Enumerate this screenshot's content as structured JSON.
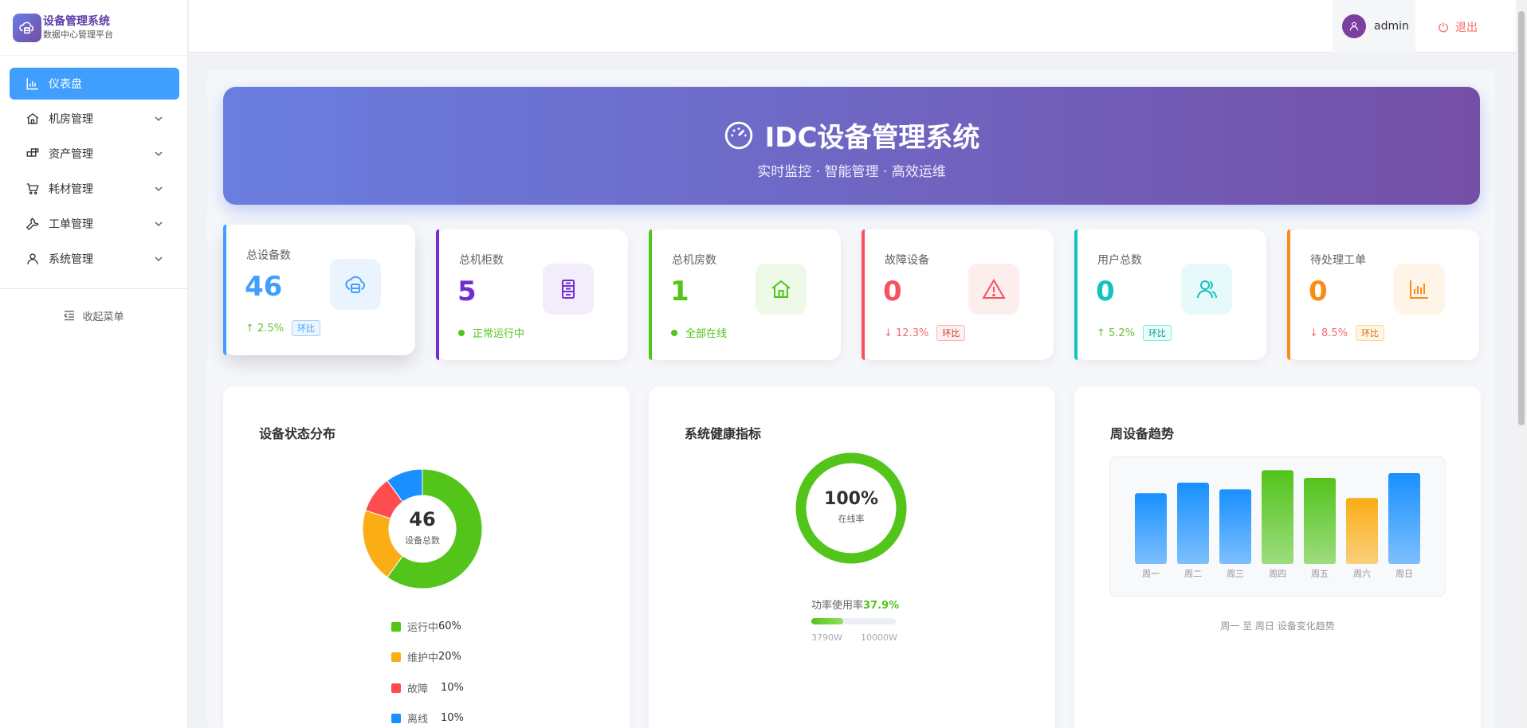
{
  "app": {
    "title": "设备管理系统",
    "subtitle": "数据中心管理平台"
  },
  "sidebar": {
    "items": [
      {
        "label": "仪表盘",
        "icon": "chart-bar-icon",
        "active": true
      },
      {
        "label": "机房管理",
        "icon": "home-icon"
      },
      {
        "label": "资产管理",
        "icon": "grid-icon"
      },
      {
        "label": "耗材管理",
        "icon": "cart-icon"
      },
      {
        "label": "工单管理",
        "icon": "wrench-icon"
      },
      {
        "label": "系统管理",
        "icon": "user-icon"
      }
    ],
    "collapse_label": "收起菜单"
  },
  "header": {
    "user": "admin",
    "logout": "退出"
  },
  "banner": {
    "title": "IDC设备管理系统",
    "subtitle": "实时监控 · 智能管理 · 高效运维"
  },
  "stats": [
    {
      "label": "总设备数",
      "value": "46",
      "color": "#409eff",
      "icon": "cloud-server-icon",
      "trend": "↑ 2.5%",
      "trend_color": "#67c23a",
      "tag": "环比",
      "tag_color": "#409eff"
    },
    {
      "label": "总机柜数",
      "value": "5",
      "color": "#722ed1",
      "icon": "server-rack-icon",
      "status": "正常运行中",
      "status_color": "#52c41a"
    },
    {
      "label": "总机房数",
      "value": "1",
      "color": "#52c41a",
      "icon": "house-icon",
      "status": "全部在线",
      "status_color": "#52c41a"
    },
    {
      "label": "故障设备",
      "value": "0",
      "color": "#f5515f",
      "icon": "warning-icon",
      "trend": "↓ 12.3%",
      "trend_color": "#f56c6c",
      "tag": "环比",
      "tag_color": "#f56c6c"
    },
    {
      "label": "用户总数",
      "value": "0",
      "color": "#13c2c2",
      "icon": "users-icon",
      "trend": "↑ 5.2%",
      "trend_color": "#67c23a",
      "tag": "环比",
      "tag_color": "#13c2c2"
    },
    {
      "label": "待处理工单",
      "value": "0",
      "color": "#fa8c16",
      "icon": "bar-chart-icon",
      "trend": "↓ 8.5%",
      "trend_color": "#f56c6c",
      "tag": "环比",
      "tag_color": "#fa8c16"
    }
  ],
  "status_card": {
    "title": "设备状态分布",
    "total": "46",
    "total_label": "设备总数",
    "slices": [
      {
        "name": "运行中",
        "pct": "60%",
        "value": 60,
        "color": "#52c41a"
      },
      {
        "name": "维护中",
        "pct": "20%",
        "value": 20,
        "color": "#faad14"
      },
      {
        "name": "故障",
        "pct": "10%",
        "value": 10,
        "color": "#ff4d4f"
      },
      {
        "name": "离线",
        "pct": "10%",
        "value": 10,
        "color": "#1890ff"
      }
    ]
  },
  "health_card": {
    "title": "系统健康指标",
    "online_rate": "100%",
    "online_label": "在线率",
    "online_value": 100,
    "power_label": "功率使用率",
    "power_rate": "37.9%",
    "power_value": 37.9,
    "power_used": "3790W",
    "power_total": "10000W"
  },
  "trend_card": {
    "title": "周设备趋势",
    "note": "周一 至 周日 设备变化趋势"
  },
  "chart_data": {
    "type": "bar",
    "categories": [
      "周一",
      "周二",
      "周三",
      "周四",
      "周五",
      "周六",
      "周日"
    ],
    "values": [
      74,
      85,
      78,
      98,
      90,
      69,
      95
    ],
    "colors": [
      "#1890ff",
      "#1890ff",
      "#1890ff",
      "#52c41a",
      "#52c41a",
      "#faad14",
      "#1890ff"
    ],
    "ylim": [
      0,
      100
    ],
    "title": "",
    "xlabel": "",
    "ylabel": ""
  }
}
